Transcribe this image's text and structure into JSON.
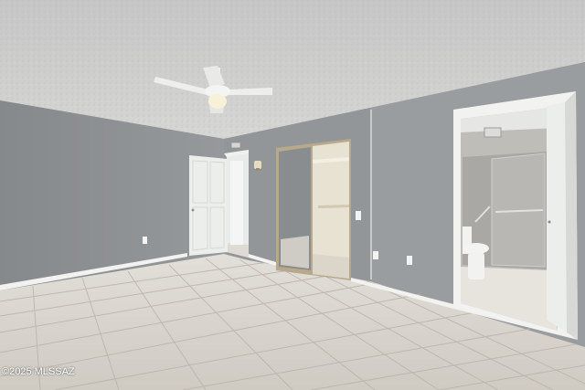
{
  "photo": {
    "watermark": "©2025 MLSSAZ",
    "colors": {
      "ceiling": "#cfd0cf",
      "wall_left": "#8f9294",
      "wall_right": "#989b9d",
      "floor": "#d8d5cf",
      "grout": "#b7b2a9",
      "baseboard": "#f2f2f0",
      "door": "#eceeec"
    }
  }
}
